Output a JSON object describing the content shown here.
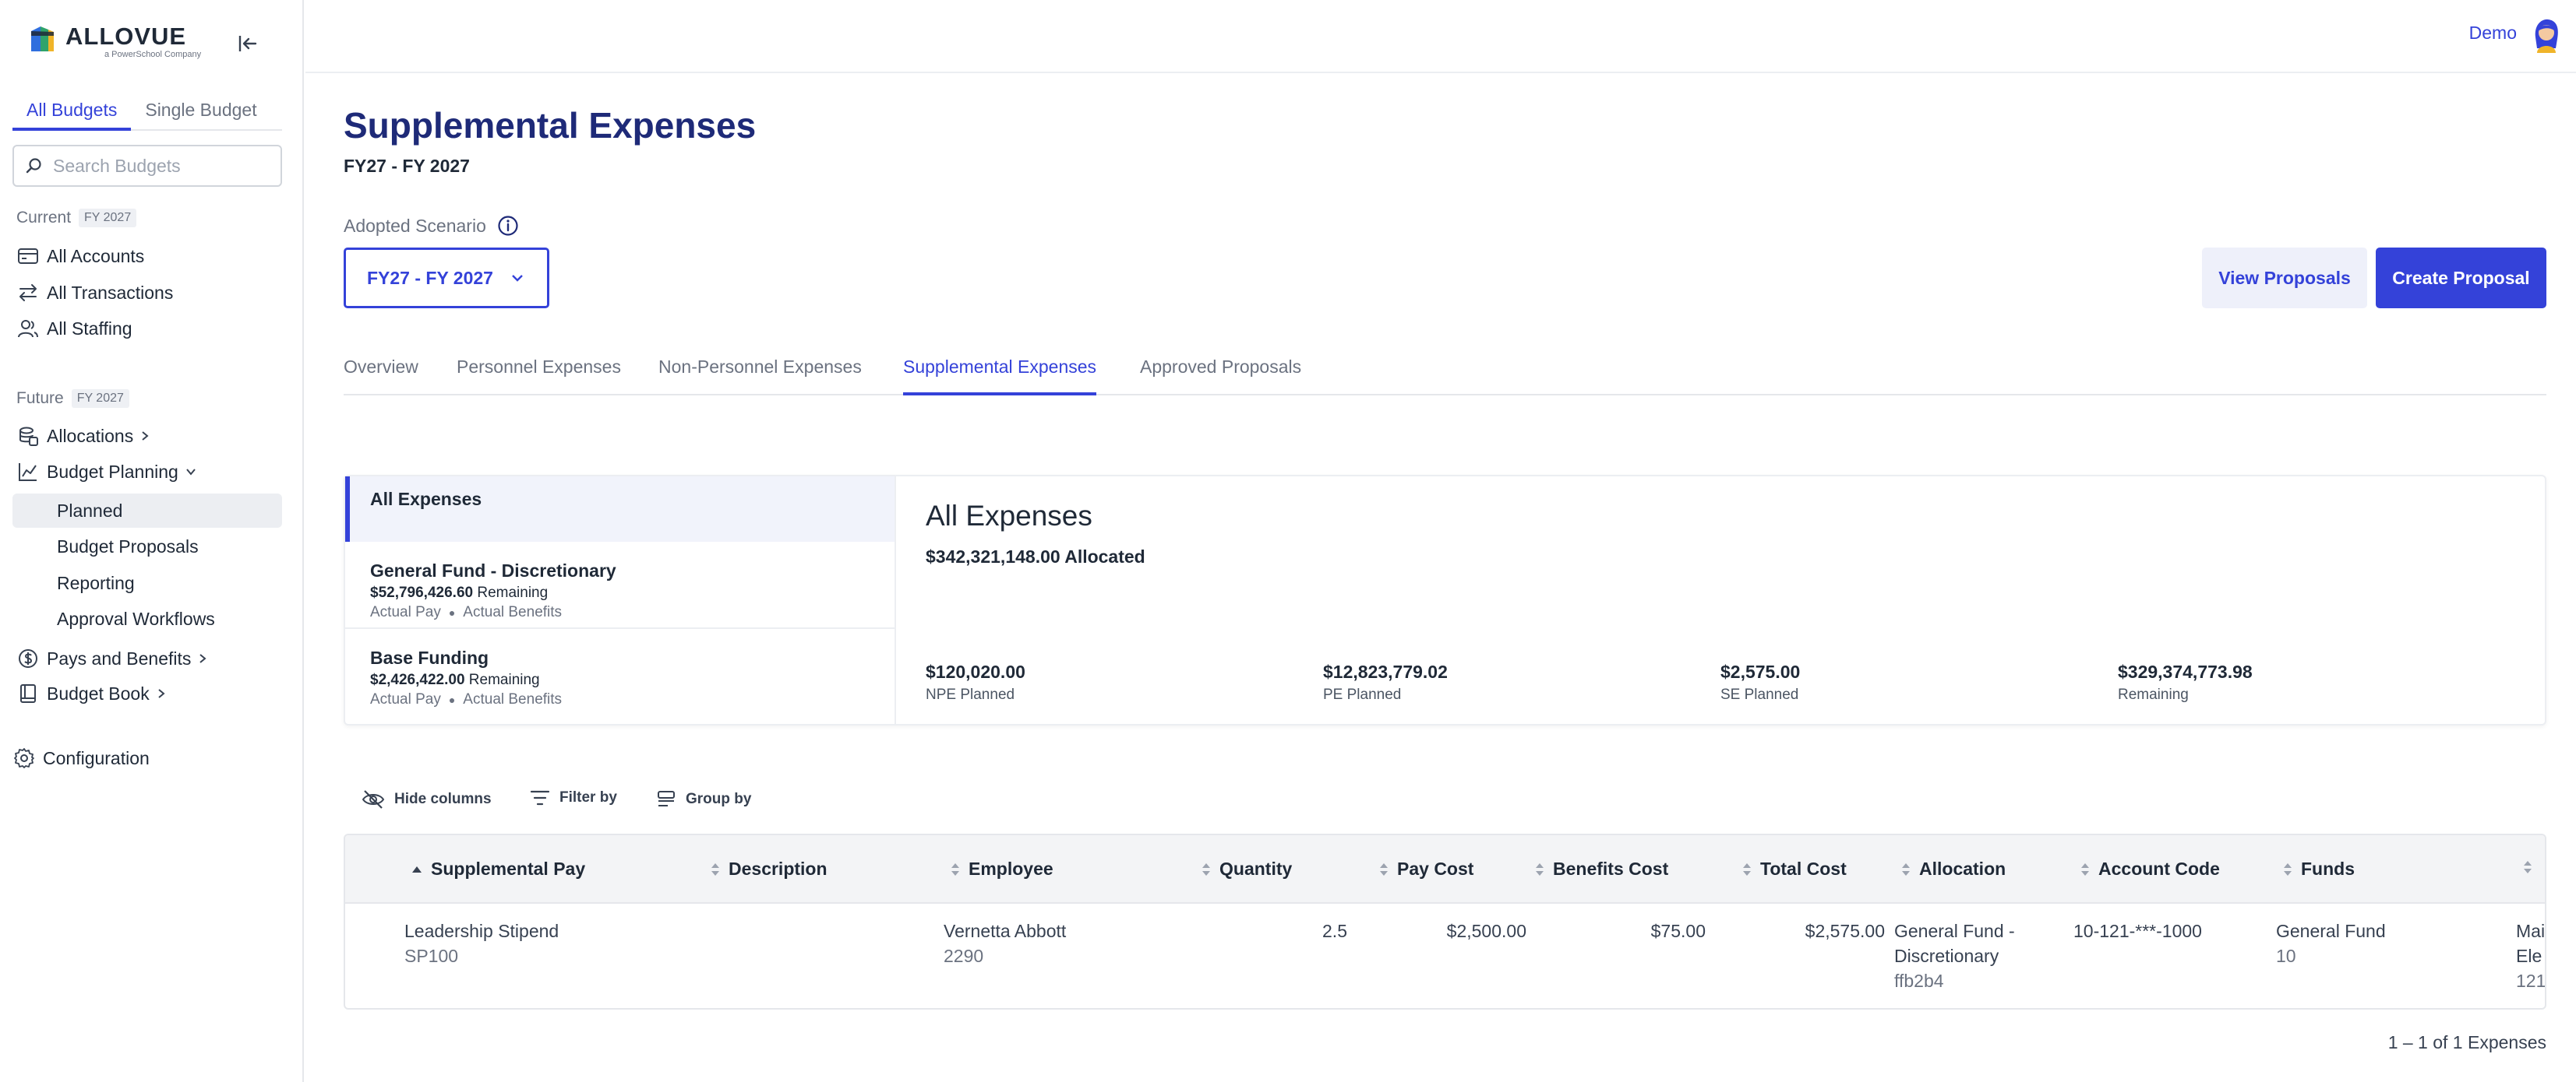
{
  "brand": {
    "name": "ALLOVUE",
    "tagline": "a PowerSchool Company"
  },
  "sidebar": {
    "tabs": [
      {
        "label": "All Budgets",
        "active": true
      },
      {
        "label": "Single Budget",
        "active": false
      }
    ],
    "search_placeholder": "Search Budgets",
    "current": {
      "label": "Current",
      "fy": "FY 2027",
      "items": [
        {
          "label": "All Accounts",
          "icon": "accounts-icon"
        },
        {
          "label": "All Transactions",
          "icon": "transactions-icon"
        },
        {
          "label": "All Staffing",
          "icon": "staffing-icon"
        }
      ]
    },
    "future": {
      "label": "Future",
      "fy": "FY 2027",
      "items": [
        {
          "label": "Allocations",
          "icon": "allocations-icon"
        },
        {
          "label": "Budget Planning",
          "icon": "budget-planning-icon"
        }
      ],
      "sub_items": [
        {
          "label": "Planned",
          "active": true
        },
        {
          "label": "Budget Proposals"
        },
        {
          "label": "Reporting"
        },
        {
          "label": "Approval Workflows"
        }
      ],
      "more_items": [
        {
          "label": "Pays and Benefits",
          "icon": "dollar-icon"
        },
        {
          "label": "Budget Book",
          "icon": "book-icon"
        }
      ]
    },
    "configuration": "Configuration"
  },
  "header": {
    "user": "Demo"
  },
  "page": {
    "title": "Supplemental Expenses",
    "subtitle": "FY27 - FY 2027",
    "scenario_label": "Adopted Scenario",
    "scenario_value": "FY27 - FY 2027",
    "view_proposals": "View Proposals",
    "create_proposal": "Create Proposal",
    "tabs": [
      {
        "label": "Overview"
      },
      {
        "label": "Personnel Expenses"
      },
      {
        "label": "Non-Personnel Expenses"
      },
      {
        "label": "Supplemental Expenses",
        "active": true
      },
      {
        "label": "Approved Proposals"
      }
    ]
  },
  "summary": {
    "funds": [
      {
        "title": "All Expenses"
      },
      {
        "title": "General Fund - Discretionary",
        "amount": "$52,796,426.60",
        "amount_suffix": "Remaining",
        "pay": "Actual Pay",
        "benefits": "Actual Benefits"
      },
      {
        "title": "Base Funding",
        "amount": "$2,426,422.00",
        "amount_suffix": "Remaining",
        "pay": "Actual Pay",
        "benefits": "Actual Benefits"
      }
    ],
    "detail": {
      "title": "All Expenses",
      "allocated": "$342,321,148.00 Allocated",
      "stats": [
        {
          "value": "$120,020.00",
          "label": "NPE Planned"
        },
        {
          "value": "$12,823,779.02",
          "label": "PE Planned"
        },
        {
          "value": "$2,575.00",
          "label": "SE Planned"
        },
        {
          "value": "$329,374,773.98",
          "label": "Remaining"
        }
      ]
    }
  },
  "toolbar": {
    "hide_columns": "Hide columns",
    "filter_by": "Filter by",
    "group_by": "Group by"
  },
  "table": {
    "columns": [
      "Supplemental Pay",
      "Description",
      "Employee",
      "Quantity",
      "Pay Cost",
      "Benefits Cost",
      "Total Cost",
      "Allocation",
      "Account Code",
      "Funds"
    ],
    "rows": [
      {
        "pay_name": "Leadership Stipend",
        "pay_code": "SP100",
        "description": "",
        "employee": "Vernetta Abbott",
        "employee_id": "2290",
        "quantity": "2.5",
        "pay_cost": "$2,500.00",
        "benefits_cost": "$75.00",
        "total_cost": "$2,575.00",
        "allocation_line1": "General Fund -",
        "allocation_line2": "Discretionary",
        "allocation_code": "ffb2b4",
        "account_code": "10-121-***-1000",
        "funds": "General Fund",
        "funds_code": "10",
        "extra_line1": "Mai",
        "extra_line2": "Ele",
        "extra_code": "121"
      }
    ],
    "pagination": "1 – 1 of 1 Expenses"
  },
  "colors": {
    "accent": "#3442d9",
    "title": "#1e2a78"
  }
}
